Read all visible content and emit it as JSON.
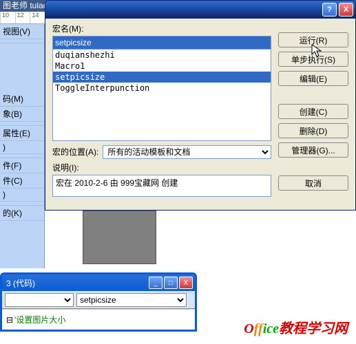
{
  "banner": "图老师 tulaoshi.com",
  "ruler": {
    "marks": [
      "10",
      "12",
      "14"
    ]
  },
  "sidebar": {
    "items": [
      {
        "label": "视图(V)",
        "key": "V"
      },
      {
        "label": "码(M)",
        "key": "M"
      },
      {
        "label": "象(B)",
        "key": "B"
      },
      {
        "label": "属性(E)",
        "key": "E"
      },
      {
        "label": ")",
        "key": ""
      },
      {
        "label": "件(F)",
        "key": "F"
      },
      {
        "label": "件(C)",
        "key": "C"
      },
      {
        "label": ")",
        "key": ""
      },
      {
        "label": "的(K)",
        "key": "K"
      }
    ]
  },
  "dialog": {
    "titlebar": {
      "help": "?",
      "close": "X"
    },
    "macro_name_label": "宏名(M):",
    "macro_name_value": "setpicsize",
    "macros": [
      "duqianshezhi",
      "Macro1",
      "setpicsize",
      "ToggleInterpunction"
    ],
    "selected_index": 2,
    "location_label": "宏的位置(A):",
    "location_value": "所有的活动模板和文档",
    "description_label": "说明(I):",
    "description_value": "宏在 2010-2-6 由 999宝藏网 创建",
    "buttons": {
      "run": "运行(R)",
      "step": "单步执行(S)",
      "edit": "编辑(E)",
      "create": "创建(C)",
      "delete": "删除(D)",
      "organizer": "管理器(G)...",
      "cancel": "取消"
    }
  },
  "win2": {
    "title": "3 (代码)",
    "combo_left": "",
    "combo_right": "setpicsize",
    "code_comment": "'设置图片大小",
    "btn_min": "_",
    "btn_max": "□",
    "btn_close": "X"
  },
  "logo": {
    "p1": "O",
    "p2": "ff",
    "p3": "ice",
    "rest": "教程学习网"
  }
}
